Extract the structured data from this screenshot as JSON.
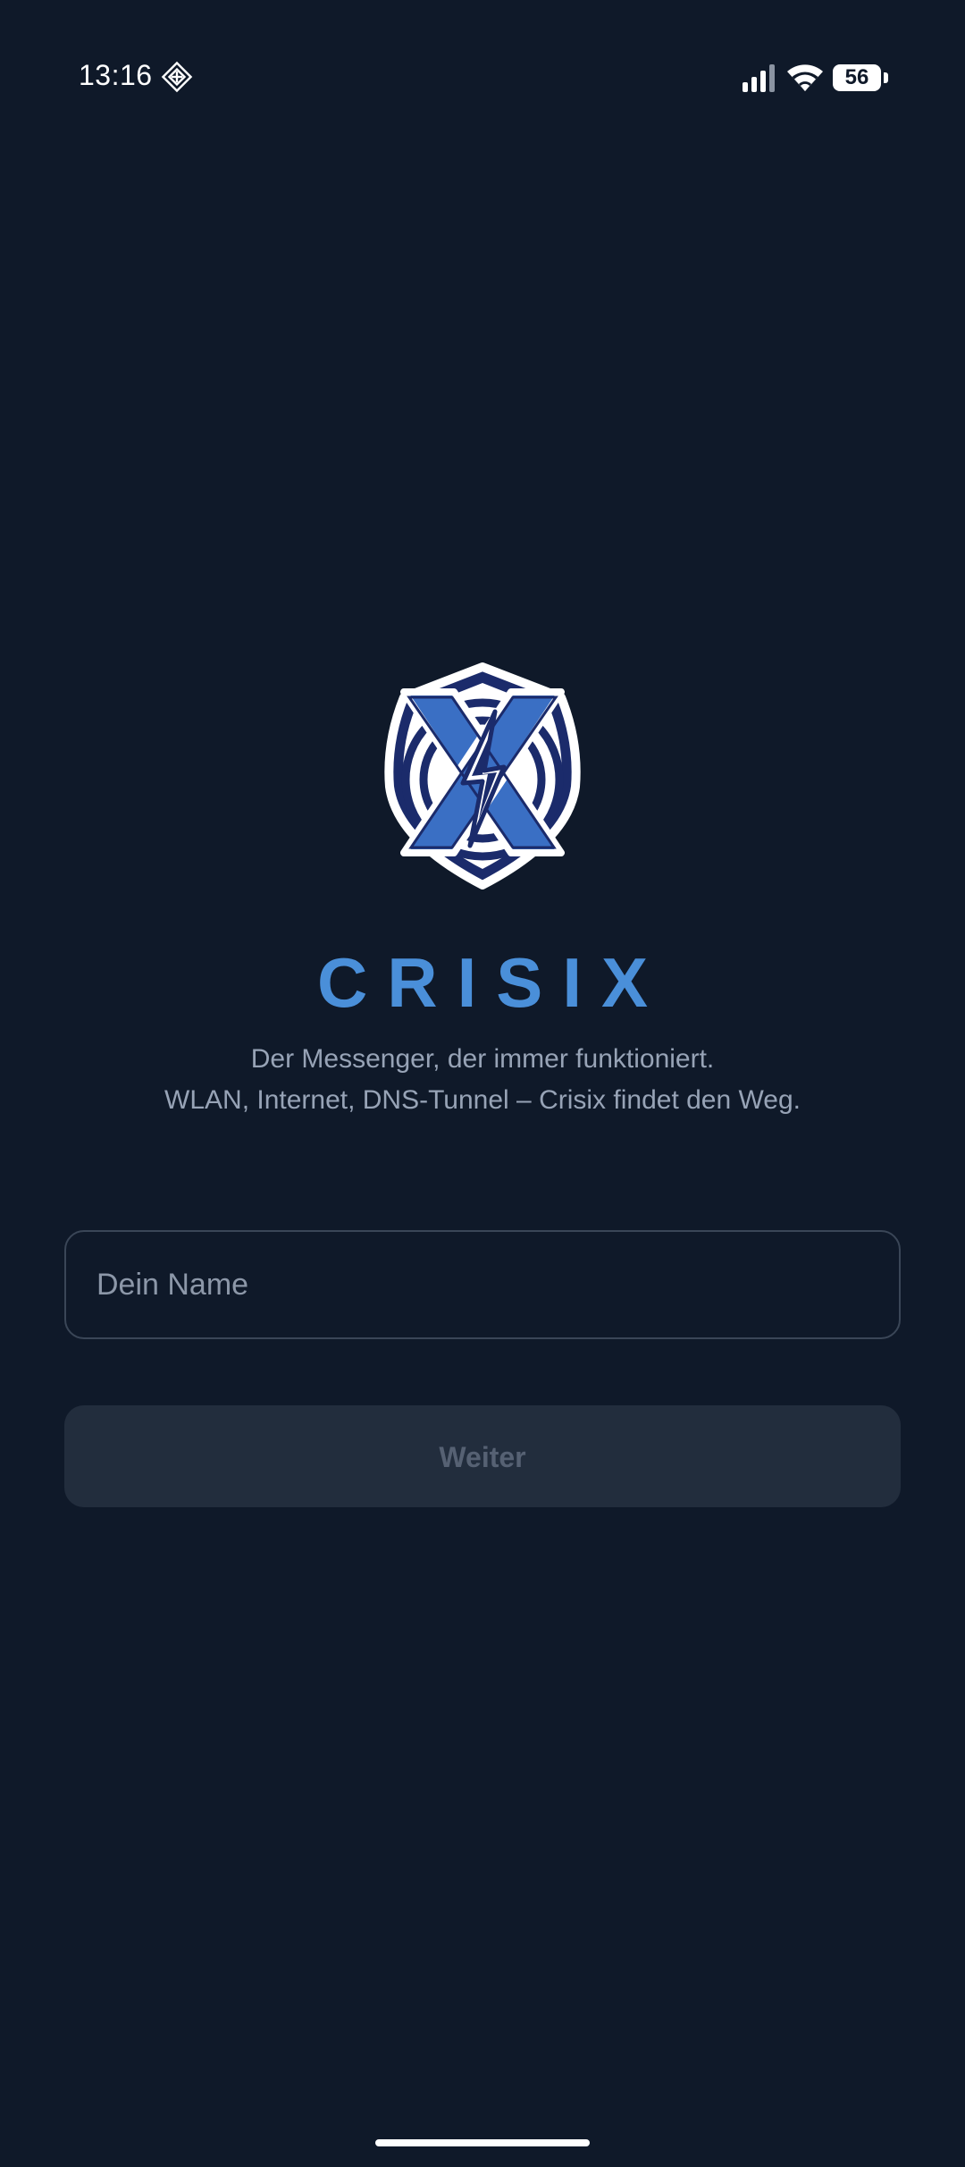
{
  "status_bar": {
    "time": "13:16",
    "battery": "56",
    "icons": [
      "nfc-icon",
      "signal-icon",
      "wifi-icon",
      "battery-icon"
    ]
  },
  "branding": {
    "logo_icon": "crisix-shield-logo-icon",
    "app_name": "CRISIX",
    "tagline_line1": "Der Messenger, der immer funktioniert.",
    "tagline_line2": "WLAN, Internet, DNS-Tunnel – Crisix findet den Weg."
  },
  "form": {
    "name_value": "",
    "name_placeholder": "Dein Name",
    "continue_label": "Weiter",
    "continue_enabled": false
  },
  "colors": {
    "background": "#0f1929",
    "accent": "#4a8fd9",
    "logo_blue": "#3a6fc4",
    "logo_navy": "#1b2b6b",
    "text_muted": "#97a3b6",
    "button_disabled_bg": "#222d3d",
    "button_disabled_text": "#566173"
  }
}
